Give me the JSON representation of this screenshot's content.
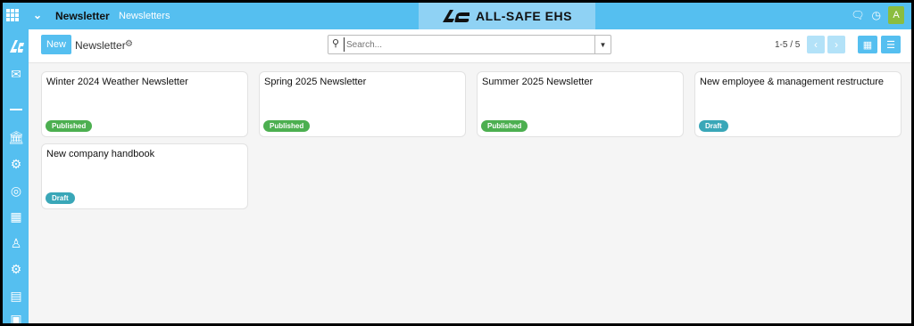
{
  "header": {
    "title": "Newsletter",
    "breadcrumb": "Newsletters",
    "logo_text": "ALL-SAFE EHS",
    "icons": [
      "apps-grid-icon",
      "chevron-down-icon",
      "chat-icon",
      "clock-icon"
    ],
    "avatar_initial": "A"
  },
  "sidebar": {
    "items": [
      "brand-logo-icon",
      "mail-icon",
      "bank-icon",
      "gears-icon",
      "target-icon",
      "chalkboard-icon",
      "group-icon",
      "cogs-icon",
      "id-card-icon",
      "portrait-icon"
    ]
  },
  "control": {
    "new_label": "New",
    "title": "Newsletter",
    "search_placeholder": "Search...",
    "pager": "1-5 / 5"
  },
  "cards": [
    {
      "title": "Winter 2024 Weather Newsletter",
      "status": "Published"
    },
    {
      "title": "Spring 2025 Newsletter",
      "status": "Published"
    },
    {
      "title": "Summer 2025 Newsletter",
      "status": "Published"
    },
    {
      "title": "New employee & management restructure",
      "status": "Draft"
    },
    {
      "title": "New company handbook",
      "status": "Draft"
    }
  ],
  "colors": {
    "accent": "#55bff0",
    "published": "#4caf50",
    "draft": "#3aa7b8"
  }
}
